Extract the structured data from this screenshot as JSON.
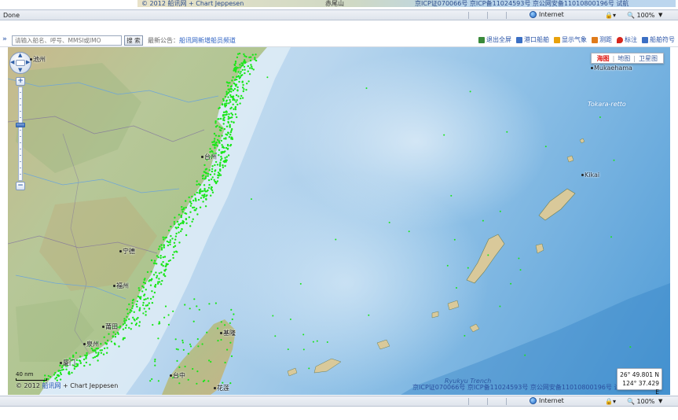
{
  "top_strip": {
    "copyright": "© 2012  船讯网 + Chart Jeppesen",
    "place": "赤尾山",
    "icp": "京ICP证070066号 京ICP备11024593号 京公网安备11010800196号 试航",
    "status_left": "Done",
    "zone": "Internet",
    "zoom": "100%"
  },
  "toolbar": {
    "chevron": "»",
    "search_placeholder": "请输入船名、呼号、MMSI或IMO",
    "search_button": "搜 索",
    "notice_prefix": "最新公告：",
    "notice_text": "船讯网新增船员频道",
    "tools": [
      {
        "label": "退出全屏",
        "icon": "fullscreen-exit-icon",
        "color": "#3a8a3a"
      },
      {
        "label": "港口船舶",
        "icon": "port-ships-icon",
        "color": "#3b6fc4"
      },
      {
        "label": "显示气象",
        "icon": "weather-icon",
        "color": "#e8a10b"
      },
      {
        "label": "测距",
        "icon": "ruler-icon",
        "color": "#e07b1a"
      },
      {
        "label": "标注",
        "icon": "pin-icon",
        "color": "#d6261c"
      },
      {
        "label": "船舶符号",
        "icon": "ship-symbol-icon",
        "color": "#3b6fc4"
      }
    ]
  },
  "map": {
    "map_types": [
      {
        "label": "海图",
        "active": true
      },
      {
        "label": "地图",
        "active": false
      },
      {
        "label": "卫星图",
        "active": false
      }
    ],
    "places": [
      {
        "name": "池州",
        "kind": "city"
      },
      {
        "name": "台州",
        "kind": "city"
      },
      {
        "name": "宁德",
        "kind": "city"
      },
      {
        "name": "福州",
        "kind": "city"
      },
      {
        "name": "莆田",
        "kind": "city"
      },
      {
        "name": "泉州",
        "kind": "city"
      },
      {
        "name": "厦门",
        "kind": "city"
      },
      {
        "name": "基隆",
        "kind": "city"
      },
      {
        "name": "台中",
        "kind": "city"
      },
      {
        "name": "花莲",
        "kind": "city"
      },
      {
        "name": "Mukaehama",
        "kind": "island"
      },
      {
        "name": "Kikai",
        "kind": "island"
      },
      {
        "name": "Tokara-retto",
        "kind": "sea"
      },
      {
        "name": "Ryukyu Trench",
        "kind": "trench"
      }
    ],
    "scale_label": "40 nm",
    "copyright_prefix": "© 2012",
    "copyright_link": "船讯网",
    "copyright_suffix": "+ Chart Jeppesen",
    "icp": "京ICP证070066号 京ICP备11024593号 京公网安备11010800196号 试航",
    "coords_lat": "26° 49.801 N",
    "coords_lon": "124° 37.429 E",
    "zoom_level_fraction": 0.6
  },
  "status_bottom": {
    "zone": "Internet",
    "zoom": "100%"
  }
}
